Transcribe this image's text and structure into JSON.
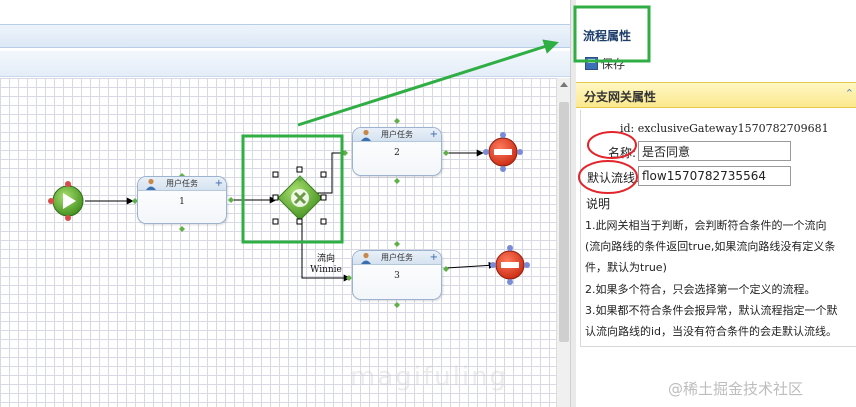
{
  "designer": {
    "tasks": [
      {
        "header": "用户任务",
        "number": "1"
      },
      {
        "header": "用户任务",
        "number": "2"
      },
      {
        "header": "用户任务",
        "number": "3"
      }
    ],
    "flow_label": [
      "流向",
      "Winnie"
    ]
  },
  "panel": {
    "title": "流程属性",
    "save_label": "保存",
    "section_title": "分支网关属性",
    "collapse_glyph": "⌃",
    "id_text": "id: exclusiveGateway1570782709681",
    "name_label": "名称:",
    "name_value": "是否同意",
    "default_flow_label": "默认流线:",
    "default_flow_value": "flow1570782735564",
    "description_title": "说明",
    "description_lines": [
      "1.此网关相当于判断，会判断符合条件的一个流向",
      "(流向路线的条件返回true,如果流向路线没有定义条",
      "件，默认为true)",
      "2.如果多个符合，只会选择第一个定义的流程。",
      "3.如果都不符合条件会报异常，默认流程指定一个默",
      "认流向路线的id，当没有符合条件的会走默认流线。"
    ]
  },
  "watermark": "@稀土掘金技术社区",
  "watermark_faint": "magifuling"
}
